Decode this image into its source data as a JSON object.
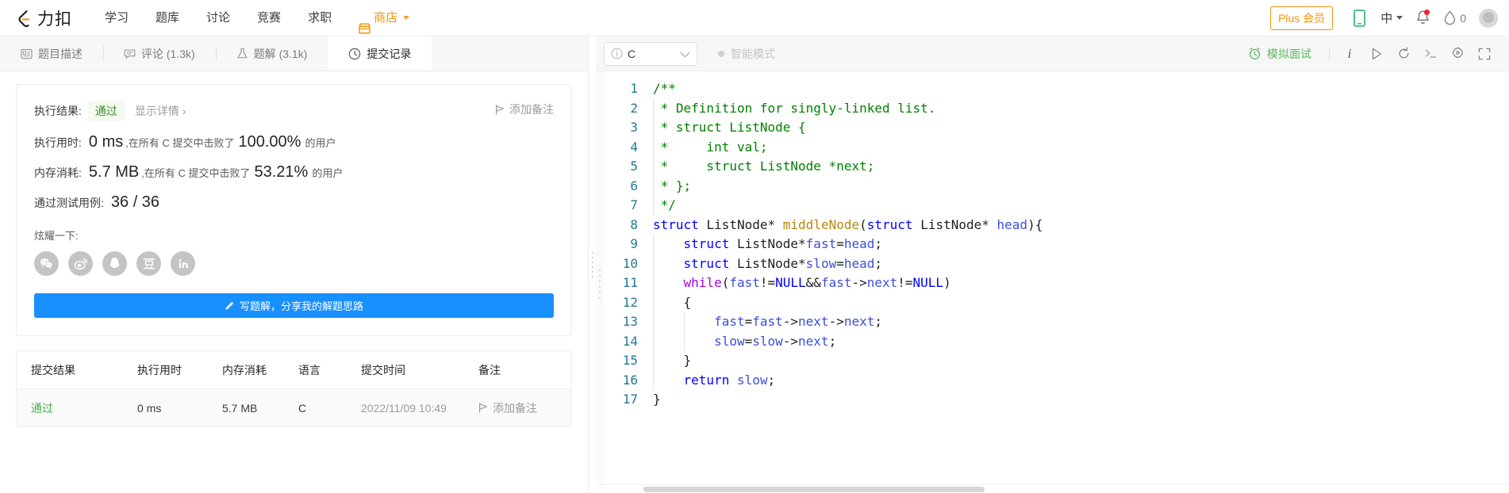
{
  "topnav": {
    "brand": "力扣",
    "links": [
      {
        "label": "学习"
      },
      {
        "label": "题库"
      },
      {
        "label": "讨论"
      },
      {
        "label": "竞赛"
      },
      {
        "label": "求职"
      }
    ],
    "shop": {
      "label": "商店"
    },
    "plus_badge": "Plus 会员",
    "language": "中",
    "fire_count": "0",
    "icons": {
      "mobile": "mobile-icon",
      "bell": "bell-icon",
      "fire": "fire-icon",
      "avatar": "avatar"
    }
  },
  "left_tabs": [
    {
      "label": "题目描述",
      "icon": "description-icon",
      "active": false
    },
    {
      "label": "评论 (1.3k)",
      "icon": "comment-icon",
      "active": false
    },
    {
      "label": "题解 (3.1k)",
      "icon": "flask-icon",
      "active": false
    },
    {
      "label": "提交记录",
      "icon": "clock-icon",
      "active": true
    }
  ],
  "result": {
    "result_label": "执行结果:",
    "status": "通过",
    "show_detail": "显示详情 ›",
    "add_note": "添加备注",
    "runtime": {
      "label": "执行用时:",
      "value": "0 ms",
      "mid_a": ",在所有 C 提交中击败了",
      "percent": "100.00%",
      "mid_b": "的用户"
    },
    "memory": {
      "label": "内存消耗:",
      "value": "5.7 MB",
      "mid_a": ",在所有 C 提交中击败了",
      "percent": "53.21%",
      "mid_b": "的用户"
    },
    "testcases": {
      "label": "通过测试用例:",
      "value": "36 / 36"
    },
    "share_label": "炫耀一下:",
    "share_icons": [
      {
        "name": "wechat-icon"
      },
      {
        "name": "weibo-icon"
      },
      {
        "name": "qq-icon"
      },
      {
        "name": "douban-icon"
      },
      {
        "name": "linkedin-icon"
      }
    ],
    "write_button": "写题解，分享我的解题思路"
  },
  "submissions": {
    "columns": [
      "提交结果",
      "执行用时",
      "内存消耗",
      "语言",
      "提交时间",
      "备注"
    ],
    "rows": [
      {
        "status": "通过",
        "runtime": "0 ms",
        "memory": "5.7 MB",
        "lang": "C",
        "time": "2022/11/09 10:49",
        "note": "添加备注"
      }
    ]
  },
  "editor_toolbar": {
    "language": "C",
    "smart_mode": "智能模式",
    "mock_interview": "模拟面试",
    "icons": [
      "info-icon",
      "run-icon",
      "reset-icon",
      "console-icon",
      "settings-icon",
      "fullscreen-icon"
    ]
  },
  "code": {
    "language": "C",
    "line_count": 17,
    "lines": [
      "/**",
      " * Definition for singly-linked list.",
      " * struct ListNode {",
      " *     int val;",
      " *     struct ListNode *next;",
      " * };",
      " */",
      "struct ListNode* middleNode(struct ListNode* head){",
      "    struct ListNode*fast=head;",
      "    struct ListNode*slow=head;",
      "    while(fast!=NULL&&fast->next!=NULL)",
      "    {",
      "        fast=fast->next->next;",
      "        slow=slow->next;",
      "    }",
      "    return slow;",
      "}"
    ]
  },
  "colors": {
    "accent_orange": "#f0940d",
    "primary_blue": "#1890ff",
    "pass_green": "#3e8e2e",
    "comment_green": "#008000",
    "keyword_blue": "#0000ff",
    "linenum_blue": "#237893"
  }
}
